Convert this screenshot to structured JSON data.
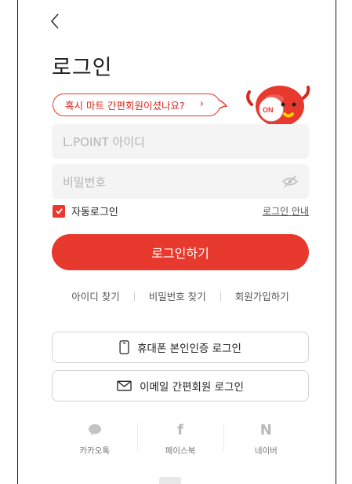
{
  "header": {
    "title": "로그인"
  },
  "promo": {
    "text": "혹시 마트 간편회원이셨나요?",
    "chevron": "›",
    "mascot_label": "LOTTE ON"
  },
  "form": {
    "id_placeholder": "L.POINT 아이디",
    "pw_placeholder": "비밀번호",
    "auto_login_label": "자동로그인",
    "auto_login_checked": true,
    "login_guide": "로그인 안내",
    "login_button": "로그인하기"
  },
  "links": {
    "find_id": "아이디 찾기",
    "find_pw": "비밀번호 찾기",
    "signup": "회원가입하기"
  },
  "alt_login": {
    "phone": "휴대폰 본인인증 로그인",
    "email": "이메일 간편회원 로그인"
  },
  "social": [
    {
      "label": "카카오톡",
      "icon": "speech-bubble-icon"
    },
    {
      "label": "페이스북",
      "icon": "f",
      "icon_name": "facebook-icon"
    },
    {
      "label": "네이버",
      "icon": "N",
      "icon_name": "naver-icon"
    }
  ],
  "colors": {
    "accent": "#e8392e",
    "field_bg": "#f4f4f4"
  }
}
